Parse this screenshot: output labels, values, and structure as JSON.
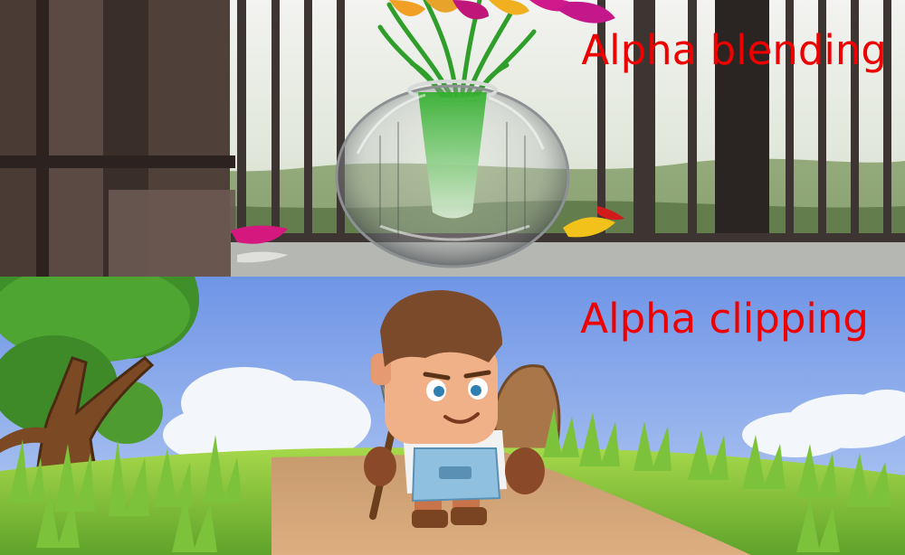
{
  "panels": {
    "top": {
      "label": "Alpha blending"
    },
    "bottom": {
      "label": "Alpha clipping"
    }
  },
  "colors": {
    "label_text": "#ee0000",
    "sky": "#8fb4ee",
    "grass": "#8dc73a",
    "path": "#d2a070",
    "window_frame": "#3a2e2a"
  }
}
